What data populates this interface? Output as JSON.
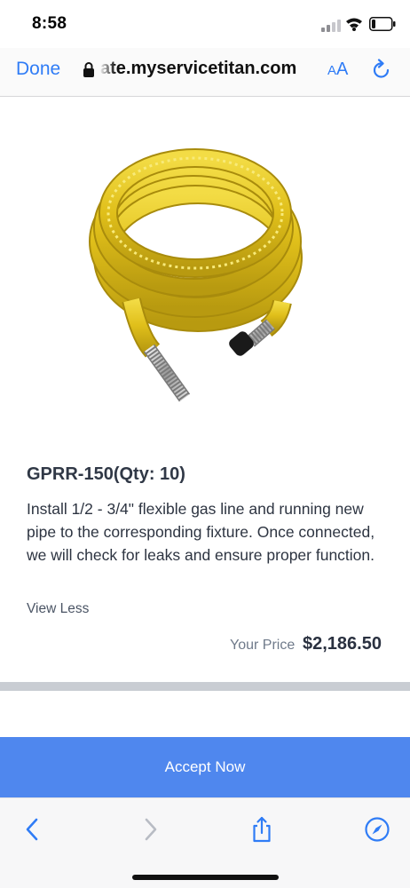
{
  "status_bar": {
    "time": "8:58"
  },
  "browser": {
    "done_label": "Done",
    "url": "ate.myservicetitan.com",
    "reader_label_small": "A",
    "reader_label_large": "A",
    "accent_color": "#2f7cf6"
  },
  "product": {
    "image_icon": "flexible-gas-line-coil",
    "title": "GPRR-150(Qty: 10)",
    "description": "Install 1/2 - 3/4\" flexible gas line and running new pipe to the corresponding fixture. Once connected, we will check for leaks and ensure proper function.",
    "toggle_label": "View Less",
    "price_label": "Your Price",
    "price_value": "$2,186.50"
  },
  "actions": {
    "accept_label": "Accept Now",
    "accept_color": "#4f87ee"
  },
  "toolbar": {
    "icons": [
      "back-icon",
      "forward-icon",
      "share-icon",
      "compass-icon"
    ]
  }
}
